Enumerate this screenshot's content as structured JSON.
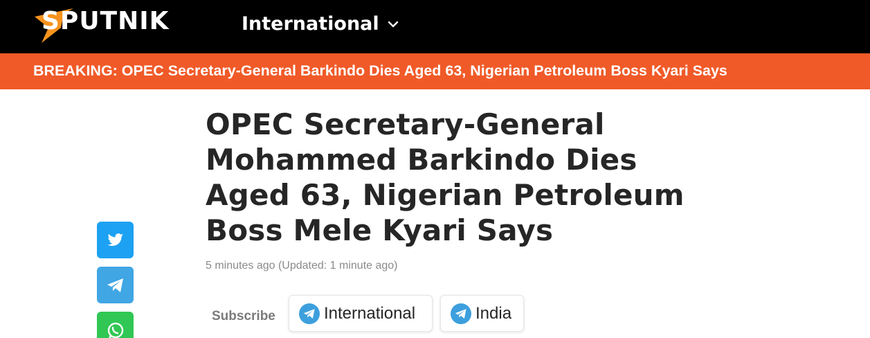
{
  "header": {
    "logo_text": "SPUTNIK",
    "edition_label": "International",
    "logo_color": "#f7931e",
    "background": "#000000"
  },
  "breaking": {
    "text": "BREAKING: OPEC Secretary-General Barkindo Dies Aged 63, Nigerian Petroleum Boss Kyari Says",
    "background": "#f05a28"
  },
  "article": {
    "title": "OPEC Secretary-General Mohammed Barkindo Dies Aged 63, Nigerian Petroleum Boss Mele Kyari Says",
    "meta": "5 minutes ago (Updated: 1 minute ago)"
  },
  "share": {
    "buttons": [
      {
        "icon": "twitter-icon",
        "color": "#1da1f2"
      },
      {
        "icon": "telegram-icon",
        "color": "#40a6e4"
      },
      {
        "icon": "whatsapp-icon",
        "color": "#31c754"
      }
    ]
  },
  "subscribe": {
    "label": "Subscribe",
    "channels": [
      {
        "label": "International",
        "icon": "telegram-icon"
      },
      {
        "label": "India",
        "icon": "telegram-icon"
      }
    ]
  }
}
